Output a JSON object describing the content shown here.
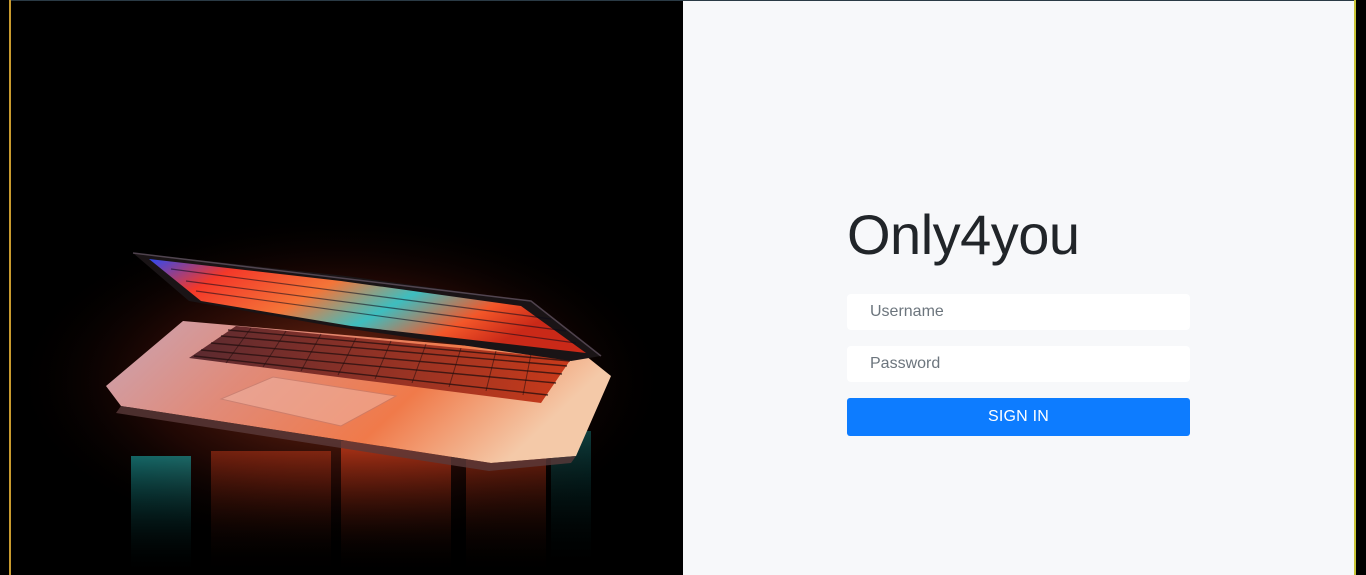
{
  "brand": {
    "title": "Only4you"
  },
  "login": {
    "username_placeholder": "Username",
    "username_value": "",
    "password_placeholder": "Password",
    "password_value": "",
    "signin_label": "SIGN IN"
  },
  "colors": {
    "accent": "#0d7cff",
    "panel_background": "#f7f8fa",
    "title_text": "#212529"
  }
}
